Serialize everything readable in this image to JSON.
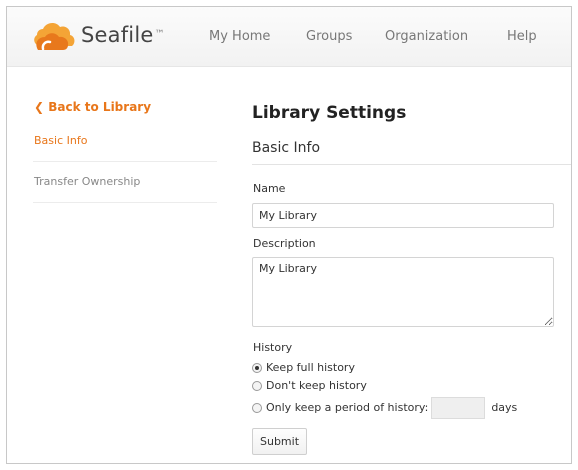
{
  "brand": {
    "name": "Seafile",
    "trademark": "™",
    "logo_icon": "seafile-cloud-logo-icon"
  },
  "nav": {
    "my_home": "My Home",
    "groups": "Groups",
    "organization": "Organization",
    "help": "Help"
  },
  "sidebar": {
    "back_label": "Back to Library",
    "back_icon": "chevron-left-icon",
    "items": [
      {
        "label": "Basic Info",
        "active": true
      },
      {
        "label": "Transfer Ownership",
        "active": false
      }
    ]
  },
  "main": {
    "title": "Library Settings",
    "section": "Basic Info",
    "name_label": "Name",
    "name_value": "My Library",
    "description_label": "Description",
    "description_value": "My Library",
    "history_label": "History",
    "history_options": [
      {
        "label": "Keep full history",
        "checked": true
      },
      {
        "label": "Don't keep history",
        "checked": false
      },
      {
        "label": "Only keep a period of history:",
        "checked": false
      }
    ],
    "days_value": "",
    "days_unit": "days",
    "submit_label": "Submit"
  },
  "colors": {
    "accent": "#e8761a",
    "text": "#333333",
    "muted": "#888888"
  }
}
